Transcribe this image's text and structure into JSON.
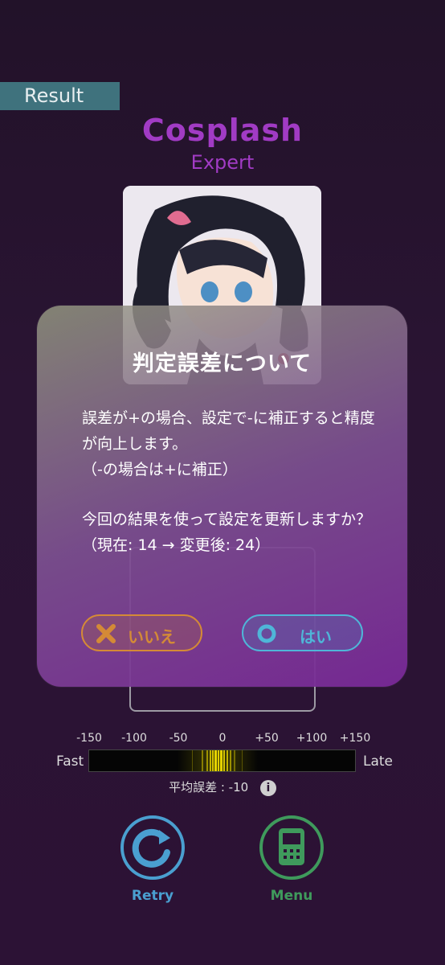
{
  "header": {
    "result_label": "Result"
  },
  "song": {
    "title": "Cosplash",
    "difficulty": "Expert"
  },
  "timing": {
    "ticks": [
      "-150",
      "-100",
      "-50",
      "0",
      "+50",
      "+100",
      "+150"
    ],
    "fast_label": "Fast",
    "late_label": "Late",
    "avg_error_text": "平均誤差 : -10",
    "avg_error_value": -10
  },
  "actions": {
    "retry_label": "Retry",
    "menu_label": "Menu"
  },
  "dialog": {
    "title": "判定誤差について",
    "body_1": "誤差が+の場合、設定で-に補正すると精度が向上します。\n（-の場合は+に補正）",
    "body_2": "今回の結果を使って設定を更新しますか？\n（現在: 14 → 変更後: 24）",
    "no_label": "いいえ",
    "yes_label": "はい"
  },
  "colors": {
    "accent_purple": "#a13bc4",
    "retry_blue": "#4a9fd0",
    "menu_green": "#3f9a5c",
    "no_orange": "#d48a36",
    "yes_cyan": "#4fb6d8"
  }
}
